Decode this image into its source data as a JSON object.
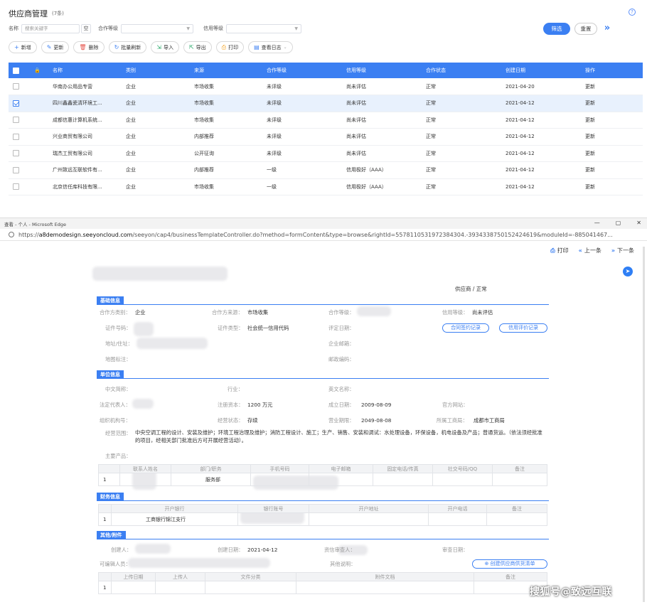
{
  "list": {
    "title": "供应商管理",
    "count": "(7条)",
    "filters": {
      "name_label": "名称",
      "name_placeholder": "搜索关键字",
      "empty_btn": "空",
      "coop_level_label": "合作等级",
      "credit_level_label": "信用等级"
    },
    "filter_btn": "筛选",
    "reset_btn": "重置",
    "toolbar": [
      {
        "icon": "plus-icon",
        "glyph": "+",
        "label": "新增"
      },
      {
        "icon": "edit-icon",
        "glyph": "✎",
        "label": "更新"
      },
      {
        "icon": "delete-icon",
        "glyph": "🗑",
        "label": "删除"
      },
      {
        "icon": "refresh-icon",
        "glyph": "↻",
        "label": "批量刷新"
      },
      {
        "icon": "import-icon",
        "glyph": "⇲",
        "label": "导入"
      },
      {
        "icon": "export-icon",
        "glyph": "⇱",
        "label": "导出"
      },
      {
        "icon": "print-icon",
        "glyph": "⎙",
        "label": "打印"
      },
      {
        "icon": "log-icon",
        "glyph": "▤",
        "label": "查看日志"
      }
    ],
    "columns": [
      "名称",
      "类别",
      "来源",
      "合作等级",
      "信用等级",
      "合作状态",
      "创建日期",
      "操作"
    ],
    "rows": [
      {
        "name": "华南办公用品专营",
        "type": "企业",
        "source": "市场收集",
        "coop": "未评级",
        "credit": "尚未评估",
        "status": "正常",
        "date": "2021-04-20",
        "action": "更新",
        "checked": false
      },
      {
        "name": "四川鑫鑫瓷清环境工...",
        "type": "企业",
        "source": "市场收集",
        "coop": "未评级",
        "credit": "尚未评估",
        "status": "正常",
        "date": "2021-04-12",
        "action": "更新",
        "checked": true
      },
      {
        "name": "成都信惠计算机系统...",
        "type": "企业",
        "source": "市场收集",
        "coop": "未评级",
        "credit": "尚未评估",
        "status": "正常",
        "date": "2021-04-12",
        "action": "更新",
        "checked": false
      },
      {
        "name": "兴业商贸有限公司",
        "type": "企业",
        "source": "内部推荐",
        "coop": "未评级",
        "credit": "尚未评估",
        "status": "正常",
        "date": "2021-04-12",
        "action": "更新",
        "checked": false
      },
      {
        "name": "瑞杰工贸有限公司",
        "type": "企业",
        "source": "公开征询",
        "coop": "未评级",
        "credit": "尚未评估",
        "status": "正常",
        "date": "2021-04-12",
        "action": "更新",
        "checked": false
      },
      {
        "name": "广州致远互联软件有...",
        "type": "企业",
        "source": "内部推荐",
        "coop": "一级",
        "credit": "信用极好（AAA）",
        "status": "正常",
        "date": "2021-04-12",
        "action": "更新",
        "checked": false
      },
      {
        "name": "北京信任库科技有限...",
        "type": "企业",
        "source": "市场收集",
        "coop": "一级",
        "credit": "信用极好（AAA）",
        "status": "正常",
        "date": "2021-04-12",
        "action": "更新",
        "checked": false
      }
    ]
  },
  "browser": {
    "window_title": "查看 - 个人 - Microsoft Edge",
    "url_prefix": "https://",
    "url_host": "a8demodesign.seeyoncloud.com",
    "url_path": "/seeyon/cap4/businessTemplateController.do?method=formContent&type=browse&rightId=5578110531972384304.-3934338750152424619&moduleId=-885041467...",
    "print": "打印",
    "prev": "上一条",
    "next": "下一条"
  },
  "form": {
    "status_breadcrumb": "供应商 / 正常",
    "sections": {
      "basic": "基础信息",
      "unit": "单位信息",
      "finance": "财务信息",
      "other": "其他/附件"
    },
    "basic": {
      "partner_type_label": "合作方类别：",
      "partner_type_value": "企业",
      "partner_source_label": "合作方来源：",
      "partner_source_value": "市场收集",
      "coop_level_label": "合作等级：",
      "credit_level_label": "信用等级：",
      "credit_level_value": "尚未评估",
      "cert_no_label": "证件号码：",
      "cert_type_label": "证件类型：",
      "cert_type_value": "社会统一信用代码",
      "eval_date_label": "评定日期：",
      "address_label": "地址/住址：",
      "email_label": "企业邮箱：",
      "map_label": "地图标注：",
      "postcode_label": "邮政编码：",
      "contract_record_btn": "合同签约记录",
      "credit_record_btn": "信用评价记录"
    },
    "unit": {
      "short_name_label": "中文简称：",
      "industry_label": "行业：",
      "en_name_label": "英文名称：",
      "legal_rep_label": "法定代表人：",
      "capital_label": "注册资本：",
      "capital_value": "1200 万元",
      "found_date_label": "成立日期：",
      "found_date_value": "2009-08-09",
      "website_label": "官方网站：",
      "org_code_label": "组织机构号：",
      "biz_status_label": "经营状态：",
      "biz_status_value": "存续",
      "biz_term_label": "营业期限：",
      "biz_term_value": "2049-08-08",
      "bureau_label": "所属工商局：",
      "bureau_value": "成都市工商局",
      "scope_label": "经营范围：",
      "scope_value": "中央空调工程的设计、安装及维护；环境工程治理及维护；消防工程设计、施工；生产、销售、安装和调试：水处理设备，环保设备，机电设备及产品；普通货运。（依法须经批准的项目，经相关部门批准后方可开展经营活动）。",
      "products_label": "主要产品："
    },
    "contacts": {
      "columns": [
        "",
        "联系人姓名",
        "部门/职务",
        "手机号码",
        "电子邮箱",
        "固定电话/传真",
        "社交号码/QQ",
        "备注"
      ],
      "rows": [
        [
          "1",
          "",
          "服务部",
          "",
          "",
          "",
          "",
          ""
        ]
      ]
    },
    "bank": {
      "columns": [
        "",
        "开户银行",
        "银行账号",
        "开户地址",
        "开户电话",
        "备注"
      ],
      "rows": [
        [
          "1",
          "工商银行锦江支行",
          "",
          "",
          "",
          ""
        ]
      ]
    },
    "other": {
      "creator_label": "创建人：",
      "create_date_label": "创建日期：",
      "create_date_value": "2021-04-12",
      "credit_reviewer_label": "资信审查人：",
      "review_date_label": "审查日期：",
      "editable_label": "可编辑人员：",
      "other_note_label": "其他说明：",
      "create_list_btn": "创建供应商供货清单"
    },
    "attachments": {
      "columns": [
        "",
        "上传日期",
        "上传人",
        "文件分类",
        "附件文档",
        "备注"
      ],
      "rows": [
        [
          "1",
          "",
          "",
          "",
          "",
          ""
        ]
      ]
    }
  },
  "watermark": "搜狐号@致远互联"
}
